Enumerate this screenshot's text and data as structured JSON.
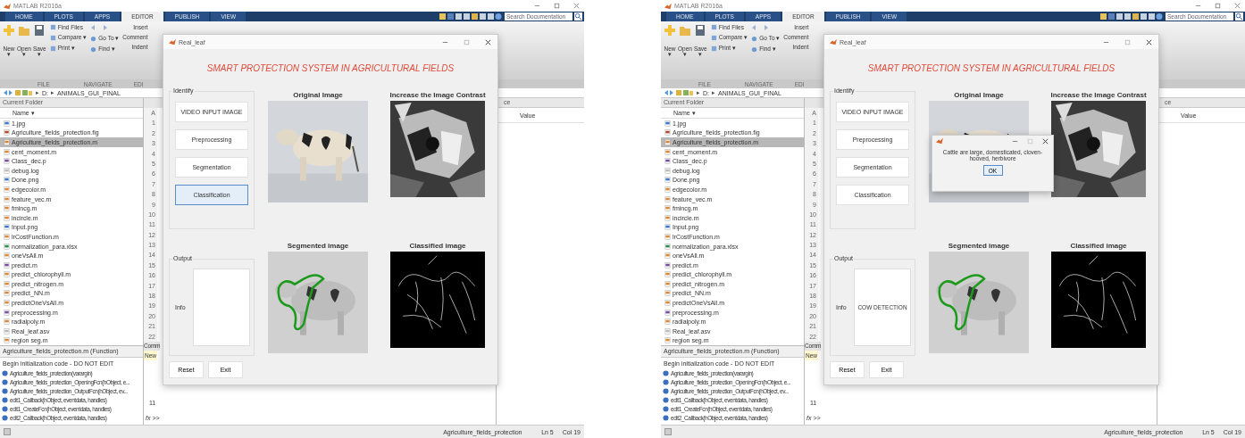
{
  "screens": [
    {
      "app_title": "MATLAB R2016a",
      "tabs": [
        {
          "label": "HOME",
          "selected": false
        },
        {
          "label": "PLOTS",
          "selected": false
        },
        {
          "label": "APPS",
          "selected": false
        },
        {
          "label": "EDITOR",
          "selected": true
        },
        {
          "label": "PUBLISH",
          "selected": false
        },
        {
          "label": "VIEW",
          "selected": false
        }
      ],
      "search": {
        "placeholder": "Search Documentation"
      },
      "toolstrip": {
        "big_buttons": [
          {
            "label": "New",
            "caret": "▾"
          },
          {
            "label": "Open",
            "caret": "▾"
          },
          {
            "label": "Save",
            "caret": "▾"
          }
        ],
        "file_buttons": [
          "Find Files",
          "Compare ▾",
          "Print ▾"
        ],
        "nav_buttons": [
          "Go To ▾",
          "Find ▾"
        ],
        "edit_buttons": [
          "Insert",
          "Comment",
          "Indent"
        ],
        "sections": [
          "FILE",
          "NAVIGATE",
          "EDI"
        ]
      },
      "path": [
        {
          "sep": "▸",
          "label": "D:"
        },
        {
          "sep": "▸",
          "label": "ANIMALS_GUI_FINAL"
        }
      ],
      "folder": {
        "title": "Current Folder",
        "column": "Name ▾",
        "files": [
          {
            "name": "1.jpg",
            "selected": false
          },
          {
            "name": "Agriculture_fields_protection.fig",
            "kind": "fig",
            "selected": false
          },
          {
            "name": "Agriculture_fields_protection.m",
            "kind": "m",
            "selected": true
          },
          {
            "name": "cent_moment.m",
            "kind": "m",
            "selected": false
          },
          {
            "name": "Class_dec.p",
            "kind": "p",
            "selected": false
          },
          {
            "name": "debug.log",
            "kind": "log",
            "selected": false
          },
          {
            "name": "Done.png",
            "selected": false
          },
          {
            "name": "edgecolor.m",
            "kind": "m",
            "selected": false
          },
          {
            "name": "feature_vec.m",
            "kind": "m",
            "selected": false
          },
          {
            "name": "fmincg.m",
            "kind": "m",
            "selected": false
          },
          {
            "name": "incircle.m",
            "kind": "m",
            "selected": false
          },
          {
            "name": "Input.png",
            "selected": false
          },
          {
            "name": "lrCostFunction.m",
            "kind": "m",
            "selected": false
          },
          {
            "name": "normalization_para.xlsx",
            "kind": "xlsx",
            "selected": false
          },
          {
            "name": "oneVsAll.m",
            "kind": "m",
            "selected": false
          },
          {
            "name": "predict.m",
            "kind": "p",
            "selected": false
          },
          {
            "name": "predict_chlorophyll.m",
            "kind": "m",
            "selected": false
          },
          {
            "name": "predict_nitrogen.m",
            "kind": "m",
            "selected": false
          },
          {
            "name": "predict_NN.m",
            "kind": "m",
            "selected": false
          },
          {
            "name": "predictOneVsAll.m",
            "kind": "m",
            "selected": false
          },
          {
            "name": "preprocessing.m",
            "kind": "p",
            "selected": false
          },
          {
            "name": "radialpoly.m",
            "kind": "m",
            "selected": false
          },
          {
            "name": "Real_leaf.asv",
            "kind": "log",
            "selected": false
          },
          {
            "name": "region seg.m",
            "kind": "m",
            "selected": false
          }
        ]
      },
      "details": {
        "title": "Agriculture_fields_protection.m  (Function)",
        "header": "Begin initialization code - DO NOT EDIT",
        "functions": [
          "Agriculture_fields_protection(varargin)",
          "Agriculture_fields_protection_OpeningFcn(hObject, e...",
          "Agriculture_fields_protection_OutputFcn(hObject, ev...",
          "edit1_Callback(hObject, eventdata, handles)",
          "edit1_CreateFcn(hObject, eventdata, handles)",
          "edit2_Callback(hObject, eventdata, handles)"
        ]
      },
      "editor": {
        "column_header": "A",
        "line_numbers": [
          "1",
          "2",
          "3",
          "4",
          "5",
          "6",
          "7",
          "8",
          "9",
          "10",
          "11",
          "12",
          "13",
          "14",
          "15",
          "16",
          "17",
          "18",
          "19",
          "20",
          "21",
          "22"
        ]
      },
      "command": {
        "tab": "Comm",
        "banner": "New",
        "lines": [
          "11"
        ],
        "prompt": "fx >>"
      },
      "workspace": {
        "title": "ce",
        "column": "Value"
      },
      "status": {
        "file": "Agriculture_fields_protection",
        "line": "Ln 5",
        "col": "Col 19"
      },
      "figure": {
        "title": "Real_leaf",
        "heading": "SMART PROTECTION SYSTEM IN AGRICULTURAL FIELDS",
        "identify": {
          "label": "Identify",
          "buttons": [
            {
              "label": "VIDEO INPUT IMAGE",
              "selected": false
            },
            {
              "label": "Preprocessing",
              "selected": false
            },
            {
              "label": "Segmentation",
              "selected": false
            },
            {
              "label": "Classification",
              "selected": true
            }
          ]
        },
        "output": {
          "label": "Output",
          "info_label": "Info"
        },
        "actions": [
          "Reset",
          "Exit"
        ],
        "images": [
          {
            "caption": "Original Image",
            "kind": "picture"
          },
          {
            "caption": "Increase the Image Contrast",
            "kind": "picture"
          },
          {
            "caption": "Segmented image",
            "kind": "picture"
          },
          {
            "caption": "Classified image",
            "kind": "picture"
          }
        ]
      }
    },
    {
      "app_title": "MATLAB R2016a",
      "tabs": [
        {
          "label": "HOME",
          "selected": false
        },
        {
          "label": "PLOTS",
          "selected": false
        },
        {
          "label": "APPS",
          "selected": false
        },
        {
          "label": "EDITOR",
          "selected": true
        },
        {
          "label": "PUBLISH",
          "selected": false
        },
        {
          "label": "VIEW",
          "selected": false
        }
      ],
      "search": {
        "placeholder": "Search Documentation"
      },
      "toolstrip": {
        "big_buttons": [
          {
            "label": "New",
            "caret": "▾"
          },
          {
            "label": "Open",
            "caret": "▾"
          },
          {
            "label": "Save",
            "caret": "▾"
          }
        ],
        "file_buttons": [
          "Find Files",
          "Compare ▾",
          "Print ▾"
        ],
        "nav_buttons": [
          "Go To ▾",
          "Find ▾"
        ],
        "edit_buttons": [
          "Insert",
          "Comment",
          "Indent"
        ],
        "sections": [
          "FILE",
          "NAVIGATE",
          "EDI"
        ]
      },
      "path": [
        {
          "sep": "▸",
          "label": "D:"
        },
        {
          "sep": "▸",
          "label": "ANIMALS_GUI_FINAL"
        }
      ],
      "folder": {
        "title": "Current Folder",
        "column": "Name ▾",
        "files": [
          {
            "name": "1.jpg",
            "selected": false
          },
          {
            "name": "Agriculture_fields_protection.fig",
            "kind": "fig",
            "selected": false
          },
          {
            "name": "Agriculture_fields_protection.m",
            "kind": "m",
            "selected": true
          },
          {
            "name": "cent_moment.m",
            "kind": "m",
            "selected": false
          },
          {
            "name": "Class_dec.p",
            "kind": "p",
            "selected": false
          },
          {
            "name": "debug.log",
            "kind": "log",
            "selected": false
          },
          {
            "name": "Done.png",
            "selected": false
          },
          {
            "name": "edgecolor.m",
            "kind": "m",
            "selected": false
          },
          {
            "name": "feature_vec.m",
            "kind": "m",
            "selected": false
          },
          {
            "name": "fmincg.m",
            "kind": "m",
            "selected": false
          },
          {
            "name": "incircle.m",
            "kind": "m",
            "selected": false
          },
          {
            "name": "Input.png",
            "selected": false
          },
          {
            "name": "lrCostFunction.m",
            "kind": "m",
            "selected": false
          },
          {
            "name": "normalization_para.xlsx",
            "kind": "xlsx",
            "selected": false
          },
          {
            "name": "oneVsAll.m",
            "kind": "m",
            "selected": false
          },
          {
            "name": "predict.m",
            "kind": "p",
            "selected": false
          },
          {
            "name": "predict_chlorophyll.m",
            "kind": "m",
            "selected": false
          },
          {
            "name": "predict_nitrogen.m",
            "kind": "m",
            "selected": false
          },
          {
            "name": "predict_NN.m",
            "kind": "m",
            "selected": false
          },
          {
            "name": "predictOneVsAll.m",
            "kind": "m",
            "selected": false
          },
          {
            "name": "preprocessing.m",
            "kind": "p",
            "selected": false
          },
          {
            "name": "radialpoly.m",
            "kind": "m",
            "selected": false
          },
          {
            "name": "Real_leaf.asv",
            "kind": "log",
            "selected": false
          },
          {
            "name": "region seg.m",
            "kind": "m",
            "selected": false
          }
        ]
      },
      "details": {
        "title": "Agriculture_fields_protection.m  (Function)",
        "header": "Begin initialization code - DO NOT EDIT",
        "functions": [
          "Agriculture_fields_protection(varargin)",
          "Agriculture_fields_protection_OpeningFcn(hObject, e...",
          "Agriculture_fields_protection_OutputFcn(hObject, ev...",
          "edit1_Callback(hObject, eventdata, handles)",
          "edit1_CreateFcn(hObject, eventdata, handles)",
          "edit2_Callback(hObject, eventdata, handles)"
        ]
      },
      "editor": {
        "column_header": "A",
        "line_numbers": [
          "1",
          "2",
          "3",
          "4",
          "5",
          "6",
          "7",
          "8",
          "9",
          "10",
          "11",
          "12",
          "13",
          "14",
          "15",
          "16",
          "17",
          "18",
          "19",
          "20",
          "21",
          "22"
        ]
      },
      "command": {
        "tab": "Comm",
        "banner": "New",
        "lines": [
          "11"
        ],
        "prompt": "fx >>"
      },
      "workspace": {
        "title": "ce",
        "column": "Value"
      },
      "status": {
        "file": "Agriculture_fields_protection",
        "line": "Ln 5",
        "col": "Col 19"
      },
      "figure": {
        "title": "Real_leaf",
        "heading": "SMART PROTECTION SYSTEM IN AGRICULTURAL FIELDS",
        "identify": {
          "label": "Identify",
          "buttons": [
            {
              "label": "VIDEO INPUT IMAGE",
              "selected": false
            },
            {
              "label": "Preprocessing",
              "selected": false
            },
            {
              "label": "Segmentation",
              "selected": false
            },
            {
              "label": "Classification",
              "selected": false
            }
          ]
        },
        "output": {
          "label": "Output",
          "info_label": "Info",
          "info_value": "COW DETECTION"
        },
        "actions": [
          "Reset",
          "Exit"
        ],
        "images": [
          {
            "caption": "Original Image",
            "kind": "picture"
          },
          {
            "caption": "Increase the Image Contrast",
            "kind": "picture"
          },
          {
            "caption": "Segmented image",
            "kind": "picture"
          },
          {
            "caption": "Classified image",
            "kind": "picture"
          }
        ]
      },
      "dialog": {
        "message": "Cattle are large, domesticated, cloven-hooved, herbivore",
        "button": "OK"
      }
    }
  ]
}
